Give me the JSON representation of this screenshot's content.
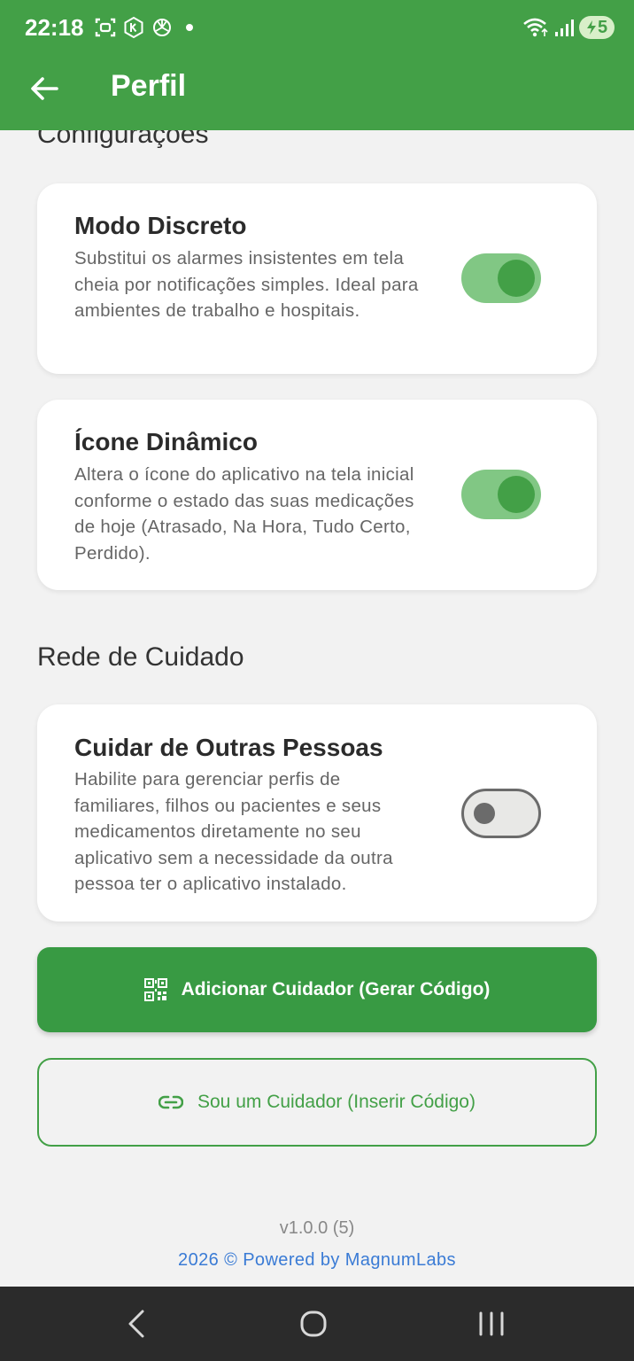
{
  "status_bar": {
    "time": "22:18",
    "battery_level": "5",
    "icons": [
      "screenshot-icon",
      "k-app-icon",
      "openai-icon",
      "notification-dot",
      "wifi-icon",
      "signal-icon",
      "battery-charging-icon"
    ]
  },
  "header": {
    "title": "Perfil",
    "back_icon": "arrow-left-icon"
  },
  "settings": {
    "section_title": "Configurações",
    "items": [
      {
        "title": "Modo Discreto",
        "description": "Substitui os alarmes insistentes em tela cheia por notificações simples. Ideal para ambientes de trabalho e hospitais.",
        "enabled": true
      },
      {
        "title": "Ícone Dinâmico",
        "description": "Altera o ícone do aplicativo na tela inicial conforme o estado das suas medicações de hoje (Atrasado, Na Hora, Tudo Certo, Perdido).",
        "enabled": true
      }
    ]
  },
  "care_network": {
    "section_title": "Rede de Cuidado",
    "item": {
      "title": "Cuidar de Outras Pessoas",
      "description": "Habilite para gerenciar perfis de familiares, filhos ou pacientes e seus medicamentos diretamente no seu aplicativo sem a necessidade da outra pessoa ter o aplicativo instalado.",
      "enabled": false
    },
    "add_caregiver_label": "Adicionar Cuidador (Gerar Código)",
    "add_caregiver_icon": "qr-code-icon",
    "i_am_caregiver_label": "Sou um Cuidador (Inserir Código)",
    "i_am_caregiver_icon": "link-icon"
  },
  "footer": {
    "version": "v1.0.0 (5)",
    "powered_by": "2026 © Powered by MagnumLabs"
  },
  "colors": {
    "primary": "#43a047",
    "button_primary": "#389a43",
    "switch_track_on": "#81c784",
    "link_blue": "#3a7bd5",
    "background": "#f2f2f2"
  },
  "nav_bar": {
    "buttons": [
      "back-nav-icon",
      "home-nav-icon",
      "recents-nav-icon"
    ]
  }
}
